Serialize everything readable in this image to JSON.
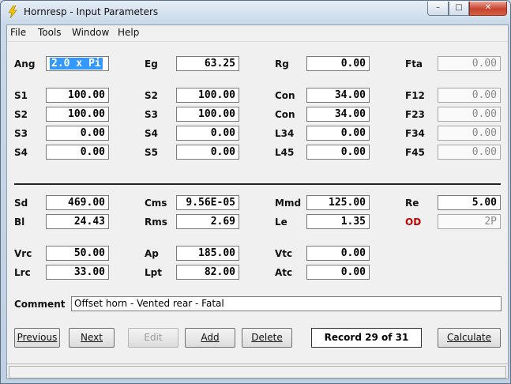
{
  "window": {
    "title": "Hornresp - Input Parameters",
    "app_icon": "lightning-bolt-icon"
  },
  "window_controls": {
    "minimize": "–",
    "maximize": "□",
    "close": "✕"
  },
  "menu": [
    "File",
    "Tools",
    "Window",
    "Help"
  ],
  "params": {
    "Ang": {
      "label": "Ang",
      "value": "2.0 x Pi"
    },
    "Eg": {
      "label": "Eg",
      "value": "63.25"
    },
    "Rg": {
      "label": "Rg",
      "value": "0.00"
    },
    "Fta": {
      "label": "Fta",
      "value": "0.00"
    },
    "S1": {
      "label": "S1",
      "value": "100.00"
    },
    "S2a": {
      "label": "S2",
      "value": "100.00"
    },
    "Con1": {
      "label": "Con",
      "value": "34.00"
    },
    "F12": {
      "label": "F12",
      "value": "0.00"
    },
    "S2b": {
      "label": "S2",
      "value": "100.00"
    },
    "S3a": {
      "label": "S3",
      "value": "100.00"
    },
    "Con2": {
      "label": "Con",
      "value": "34.00"
    },
    "F23": {
      "label": "F23",
      "value": "0.00"
    },
    "S3b": {
      "label": "S3",
      "value": "0.00"
    },
    "S4a": {
      "label": "S4",
      "value": "0.00"
    },
    "L34": {
      "label": "L34",
      "value": "0.00"
    },
    "F34": {
      "label": "F34",
      "value": "0.00"
    },
    "S4b": {
      "label": "S4",
      "value": "0.00"
    },
    "S5": {
      "label": "S5",
      "value": "0.00"
    },
    "L45": {
      "label": "L45",
      "value": "0.00"
    },
    "F45": {
      "label": "F45",
      "value": "0.00"
    },
    "Sd": {
      "label": "Sd",
      "value": "469.00"
    },
    "Cms": {
      "label": "Cms",
      "value": "9.56E-05"
    },
    "Mmd": {
      "label": "Mmd",
      "value": "125.00"
    },
    "Re": {
      "label": "Re",
      "value": "5.00"
    },
    "Bl": {
      "label": "Bl",
      "value": "24.43"
    },
    "Rms": {
      "label": "Rms",
      "value": "2.69"
    },
    "Le": {
      "label": "Le",
      "value": "1.35"
    },
    "OD": {
      "label": "OD",
      "value": "2P"
    },
    "Vrc": {
      "label": "Vrc",
      "value": "50.00"
    },
    "Ap": {
      "label": "Ap",
      "value": "185.00"
    },
    "Vtc": {
      "label": "Vtc",
      "value": "0.00"
    },
    "Lrc": {
      "label": "Lrc",
      "value": "33.00"
    },
    "Lpt": {
      "label": "Lpt",
      "value": "82.00"
    },
    "Atc": {
      "label": "Atc",
      "value": "0.00"
    }
  },
  "comment": {
    "label": "Comment",
    "value": "Offset horn - Vented rear - Fatal"
  },
  "buttons": {
    "previous": "Previous",
    "next": "Next",
    "edit": "Edit",
    "add": "Add",
    "delete": "Delete",
    "calculate": "Calculate"
  },
  "record": "Record 29 of 31",
  "colors": {
    "od_label": "#c00000",
    "selection": "#3399ff"
  }
}
